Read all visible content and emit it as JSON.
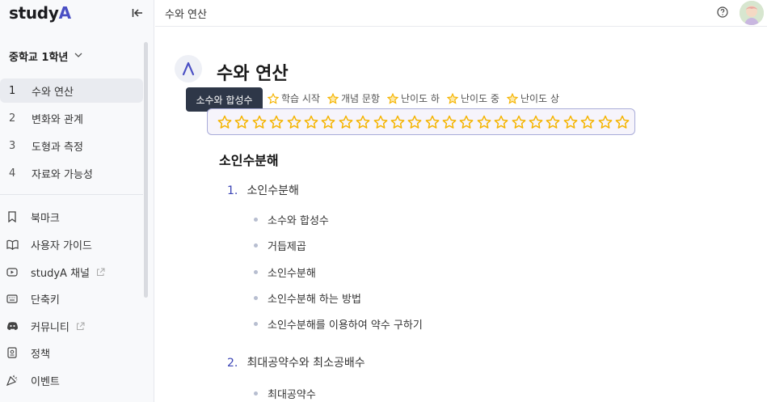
{
  "app": {
    "logo_text": "study",
    "logo_accent": "A"
  },
  "sidebar": {
    "grade": "중학교 1학년",
    "units": [
      {
        "num": "1",
        "label": "수와 연산",
        "active": true
      },
      {
        "num": "2",
        "label": "변화와 관계",
        "active": false
      },
      {
        "num": "3",
        "label": "도형과 측정",
        "active": false
      },
      {
        "num": "4",
        "label": "자료와 가능성",
        "active": false
      }
    ],
    "links": [
      {
        "label": "북마크",
        "icon": "bookmark-icon",
        "external": false
      },
      {
        "label": "사용자 가이드",
        "icon": "book-open-icon",
        "external": false
      },
      {
        "label": "studyA 채널",
        "icon": "youtube-icon",
        "external": true
      },
      {
        "label": "단축키",
        "icon": "keyboard-icon",
        "external": false
      },
      {
        "label": "커뮤니티",
        "icon": "discord-icon",
        "external": true
      },
      {
        "label": "정책",
        "icon": "policy-icon",
        "external": false
      },
      {
        "label": "이벤트",
        "icon": "party-popper-icon",
        "external": false
      }
    ]
  },
  "topbar": {
    "breadcrumb": "수와 연산"
  },
  "main": {
    "title": "수와 연산",
    "tooltip": "소수와 합성수",
    "legend": [
      "학습 시작",
      "개념 문항",
      "난이도 하",
      "난이도 중",
      "난이도 상"
    ],
    "stars_count": 24,
    "section_heading": "소인수분해",
    "topics": [
      {
        "num": "1.",
        "label": "소인수분해",
        "items": [
          "소수와 합성수",
          "거듭제곱",
          "소인수분해",
          "소인수분해 하는 방법",
          "소인수분해를 이용하여 약수 구하기"
        ]
      },
      {
        "num": "2.",
        "label": "최대공약수와 최소공배수",
        "items": [
          "최대공약수"
        ]
      }
    ]
  },
  "colors": {
    "accent": "#4a4fc4",
    "star": "#f5b400",
    "sidebar_bg": "#f8f9fb"
  }
}
